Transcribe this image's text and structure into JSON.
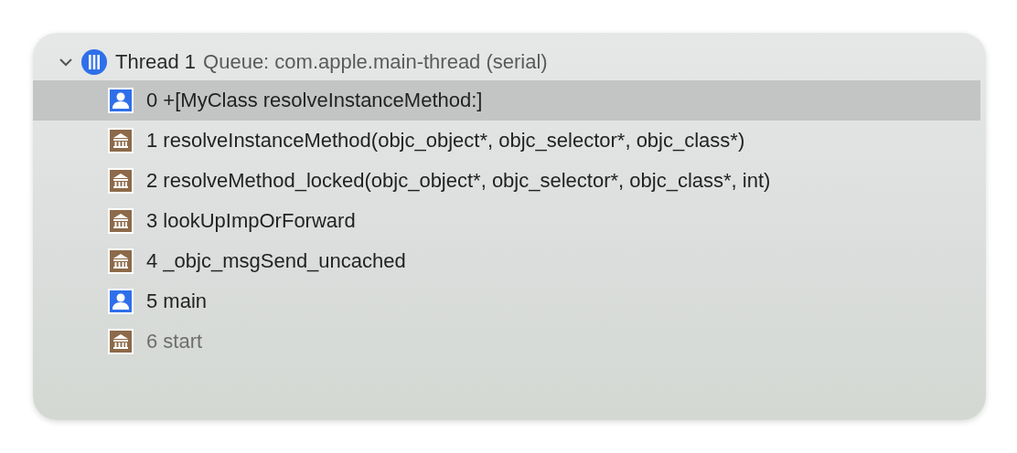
{
  "thread": {
    "expanded": true,
    "name": "Thread 1",
    "queue": "Queue: com.apple.main-thread (serial)"
  },
  "frames": [
    {
      "kind": "user",
      "label": "0 +[MyClass resolveInstanceMethod:]",
      "selected": true,
      "dimmed": false
    },
    {
      "kind": "system",
      "label": "1 resolveInstanceMethod(objc_object*, objc_selector*, objc_class*)",
      "selected": false,
      "dimmed": false
    },
    {
      "kind": "system",
      "label": "2 resolveMethod_locked(objc_object*, objc_selector*, objc_class*, int)",
      "selected": false,
      "dimmed": false
    },
    {
      "kind": "system",
      "label": "3 lookUpImpOrForward",
      "selected": false,
      "dimmed": false
    },
    {
      "kind": "system",
      "label": "4 _objc_msgSend_uncached",
      "selected": false,
      "dimmed": false
    },
    {
      "kind": "user",
      "label": "5 main",
      "selected": false,
      "dimmed": false
    },
    {
      "kind": "system",
      "label": "6 start",
      "selected": false,
      "dimmed": true
    }
  ]
}
